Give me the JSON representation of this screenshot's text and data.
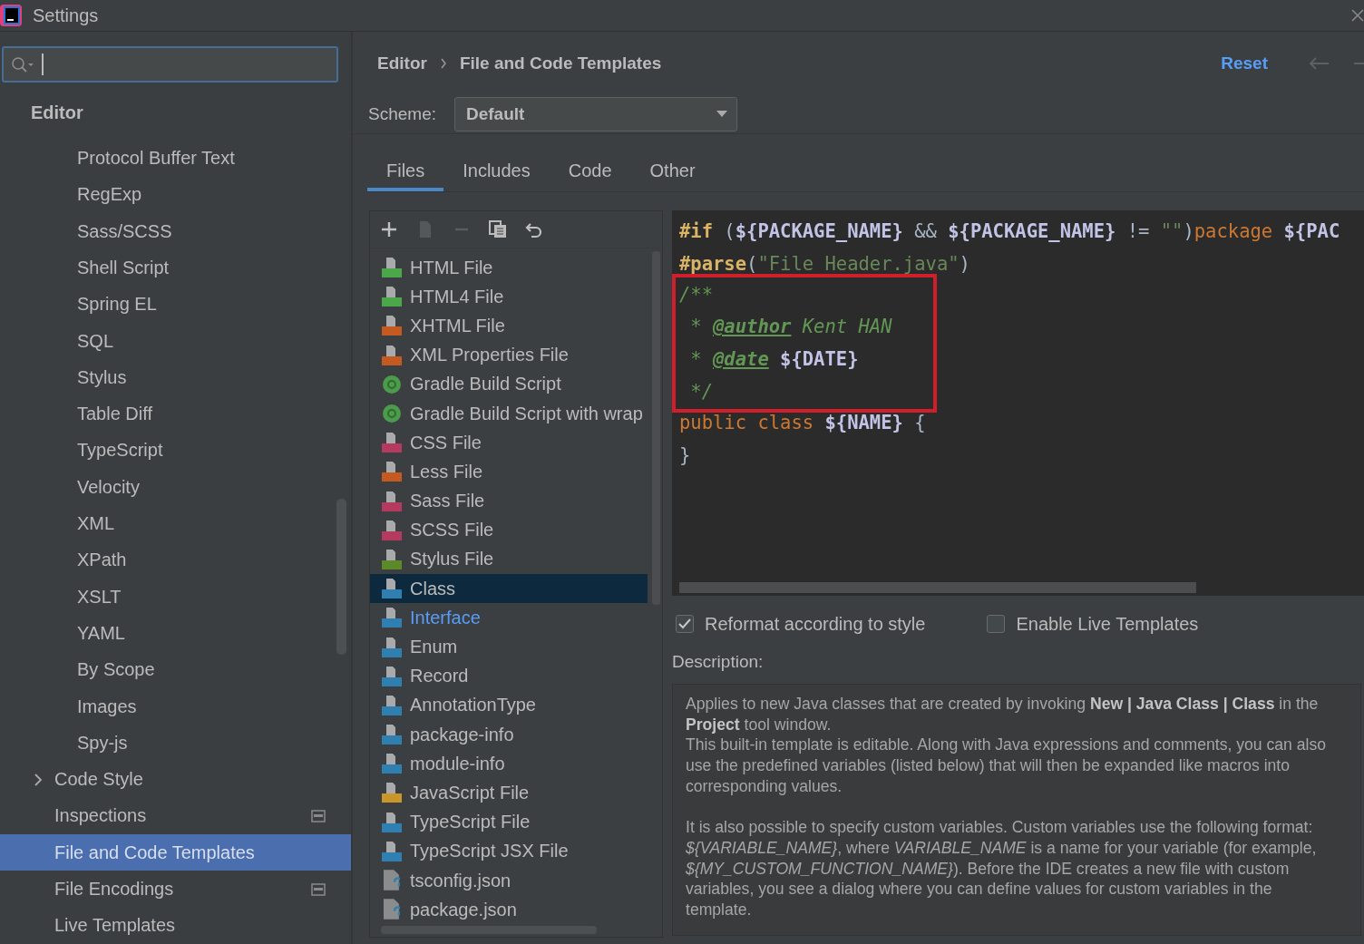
{
  "window": {
    "title": "Settings"
  },
  "sidebar": {
    "section": "Editor",
    "items": [
      {
        "label": "Protocol Buffer Text",
        "kind": "child",
        "selected": false,
        "project_scoped": false
      },
      {
        "label": "RegExp",
        "kind": "child",
        "selected": false,
        "project_scoped": false
      },
      {
        "label": "Sass/SCSS",
        "kind": "child",
        "selected": false,
        "project_scoped": false
      },
      {
        "label": "Shell Script",
        "kind": "child",
        "selected": false,
        "project_scoped": false
      },
      {
        "label": "Spring EL",
        "kind": "child",
        "selected": false,
        "project_scoped": false
      },
      {
        "label": "SQL",
        "kind": "child",
        "selected": false,
        "project_scoped": false
      },
      {
        "label": "Stylus",
        "kind": "child",
        "selected": false,
        "project_scoped": false
      },
      {
        "label": "Table Diff",
        "kind": "child",
        "selected": false,
        "project_scoped": false
      },
      {
        "label": "TypeScript",
        "kind": "child",
        "selected": false,
        "project_scoped": false
      },
      {
        "label": "Velocity",
        "kind": "child",
        "selected": false,
        "project_scoped": false
      },
      {
        "label": "XML",
        "kind": "child",
        "selected": false,
        "project_scoped": false
      },
      {
        "label": "XPath",
        "kind": "child",
        "selected": false,
        "project_scoped": false
      },
      {
        "label": "XSLT",
        "kind": "child",
        "selected": false,
        "project_scoped": false
      },
      {
        "label": "YAML",
        "kind": "child",
        "selected": false,
        "project_scoped": false
      },
      {
        "label": "By Scope",
        "kind": "child",
        "selected": false,
        "project_scoped": false
      },
      {
        "label": "Images",
        "kind": "child",
        "selected": false,
        "project_scoped": false
      },
      {
        "label": "Spy-js",
        "kind": "child",
        "selected": false,
        "project_scoped": false
      },
      {
        "label": "Code Style",
        "kind": "group",
        "expanded": false,
        "selected": false,
        "project_scoped": false
      },
      {
        "label": "Inspections",
        "kind": "page",
        "selected": false,
        "project_scoped": true
      },
      {
        "label": "File and Code Templates",
        "kind": "page",
        "selected": true,
        "project_scoped": false
      },
      {
        "label": "File Encodings",
        "kind": "page",
        "selected": false,
        "project_scoped": true
      },
      {
        "label": "Live Templates",
        "kind": "page",
        "selected": false,
        "project_scoped": false
      }
    ]
  },
  "breadcrumb": [
    "Editor",
    "File and Code Templates"
  ],
  "reset": "Reset",
  "scheme": {
    "label": "Scheme:",
    "value": "Default"
  },
  "tabs": [
    {
      "label": "Files",
      "selected": true
    },
    {
      "label": "Includes",
      "selected": false
    },
    {
      "label": "Code",
      "selected": false
    },
    {
      "label": "Other",
      "selected": false
    }
  ],
  "templates": [
    {
      "label": "HTML File",
      "kind": "html",
      "selected": false,
      "modified": false
    },
    {
      "label": "HTML4 File",
      "kind": "html",
      "selected": false,
      "modified": false
    },
    {
      "label": "XHTML File",
      "kind": "xhtml",
      "selected": false,
      "modified": false
    },
    {
      "label": "XML Properties File",
      "kind": "xml",
      "selected": false,
      "modified": false
    },
    {
      "label": "Gradle Build Script",
      "kind": "gradle",
      "selected": false,
      "modified": false
    },
    {
      "label": "Gradle Build Script with wrap",
      "kind": "gradle",
      "selected": false,
      "modified": false
    },
    {
      "label": "CSS File",
      "kind": "css",
      "selected": false,
      "modified": false
    },
    {
      "label": "Less File",
      "kind": "less",
      "selected": false,
      "modified": false
    },
    {
      "label": "Sass File",
      "kind": "sass",
      "selected": false,
      "modified": false
    },
    {
      "label": "SCSS File",
      "kind": "sass",
      "selected": false,
      "modified": false
    },
    {
      "label": "Stylus File",
      "kind": "styl",
      "selected": false,
      "modified": false
    },
    {
      "label": "Class",
      "kind": "java",
      "selected": true,
      "modified": false
    },
    {
      "label": "Interface",
      "kind": "java",
      "selected": false,
      "modified": true
    },
    {
      "label": "Enum",
      "kind": "java",
      "selected": false,
      "modified": false
    },
    {
      "label": "Record",
      "kind": "java",
      "selected": false,
      "modified": false
    },
    {
      "label": "AnnotationType",
      "kind": "java",
      "selected": false,
      "modified": false
    },
    {
      "label": "package-info",
      "kind": "java",
      "selected": false,
      "modified": false
    },
    {
      "label": "module-info",
      "kind": "java",
      "selected": false,
      "modified": false
    },
    {
      "label": "JavaScript File",
      "kind": "js",
      "selected": false,
      "modified": false
    },
    {
      "label": "TypeScript File",
      "kind": "ts",
      "selected": false,
      "modified": false
    },
    {
      "label": "TypeScript JSX File",
      "kind": "ts",
      "selected": false,
      "modified": false
    },
    {
      "label": "tsconfig.json",
      "kind": "json",
      "selected": false,
      "modified": false
    },
    {
      "label": "package.json",
      "kind": "json",
      "selected": false,
      "modified": false
    }
  ],
  "editor": {
    "lines": [
      {
        "highlighted": false,
        "tokens": [
          {
            "kind": "directive",
            "t": "#if"
          },
          {
            "kind": "plain",
            "t": " ("
          },
          {
            "kind": "var",
            "t": "${PACKAGE_NAME}"
          },
          {
            "kind": "plain",
            "t": " && "
          },
          {
            "kind": "var",
            "t": "${PACKAGE_NAME}"
          },
          {
            "kind": "plain",
            "t": " != "
          },
          {
            "kind": "string",
            "t": "\"\""
          },
          {
            "kind": "plain",
            "t": ")"
          },
          {
            "kind": "keyword",
            "t": "package "
          },
          {
            "kind": "var",
            "t": "${PAC"
          }
        ]
      },
      {
        "highlighted": false,
        "tokens": [
          {
            "kind": "directive",
            "t": "#parse"
          },
          {
            "kind": "plain",
            "t": "("
          },
          {
            "kind": "string",
            "t": "\"File Header.java\""
          },
          {
            "kind": "plain",
            "t": ")"
          }
        ]
      },
      {
        "highlighted": true,
        "tokens": [
          {
            "kind": "comment",
            "t": "/**"
          }
        ]
      },
      {
        "highlighted": true,
        "tokens": [
          {
            "kind": "comment",
            "t": " * "
          },
          {
            "kind": "tag",
            "t": "@author"
          },
          {
            "kind": "comment",
            "t": " Kent HAN"
          }
        ]
      },
      {
        "highlighted": true,
        "tokens": [
          {
            "kind": "comment",
            "t": " * "
          },
          {
            "kind": "tag",
            "t": "@date"
          },
          {
            "kind": "var",
            "t": " ${DATE}"
          }
        ]
      },
      {
        "highlighted": true,
        "tokens": [
          {
            "kind": "comment",
            "t": " */"
          }
        ]
      },
      {
        "highlighted": false,
        "tokens": [
          {
            "kind": "keyword",
            "t": "public class "
          },
          {
            "kind": "var",
            "t": "${NAME}"
          },
          {
            "kind": "plain",
            "t": " {"
          }
        ]
      },
      {
        "highlighted": false,
        "tokens": [
          {
            "kind": "plain",
            "t": "}"
          }
        ]
      }
    ]
  },
  "options": [
    {
      "label": "Reformat according to style",
      "checked": true
    },
    {
      "label": "Enable Live Templates",
      "checked": false
    }
  ],
  "description": {
    "label": "Description:",
    "blocks": [
      [
        "Applies to new Java classes that are created by invoking **New | Java Class | Class** in the **Project** tool window.",
        "This built-in template is editable. Along with Java expressions and comments, you can also use the predefined variables (listed below) that will then be expanded like macros into corresponding values."
      ],
      [
        "It is also possible to specify custom variables. Custom variables use the following format: *${VARIABLE_NAME}*, where *VARIABLE_NAME* is a name for your variable (for example, *${MY_CUSTOM_FUNCTION_NAME}*). Before the IDE creates a new file with custom variables, you see a dialog where you can define values for custom variables in the template."
      ]
    ]
  }
}
